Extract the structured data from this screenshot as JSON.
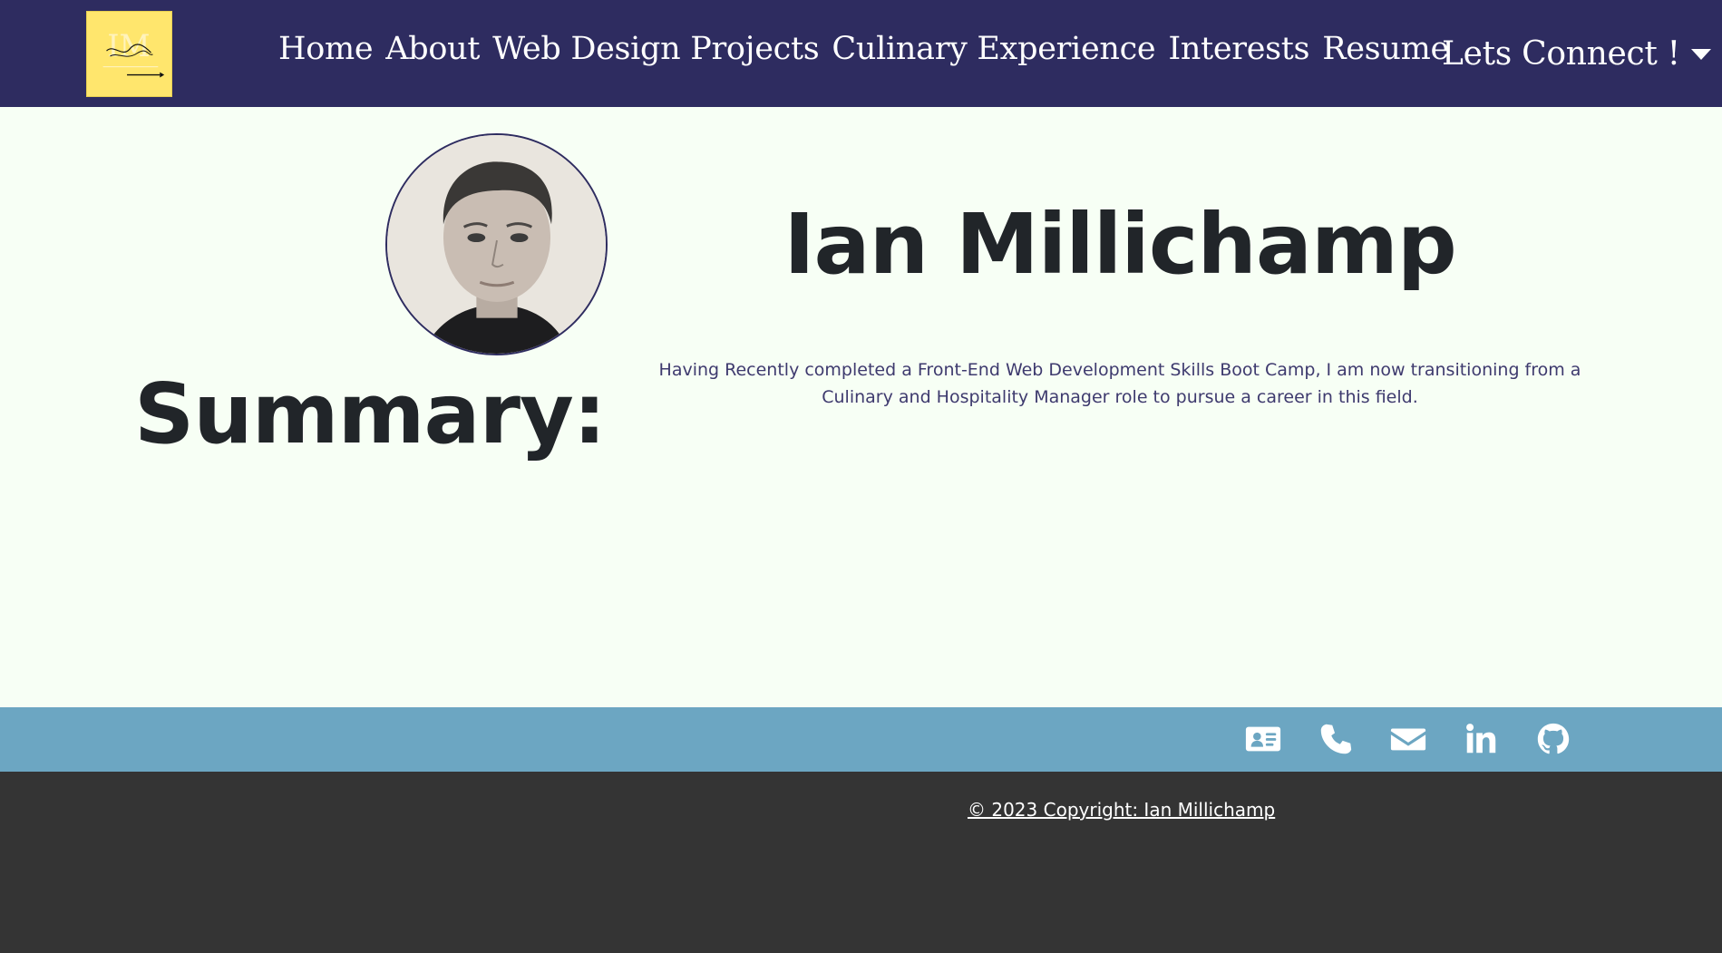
{
  "navbar": {
    "background": "#2e2c60",
    "logo_icon": "IM-monogram-logo",
    "links": [
      {
        "label": "Home"
      },
      {
        "label": "About"
      },
      {
        "label": "Web Design Projects"
      },
      {
        "label": "Culinary Experience"
      },
      {
        "label": "Interests"
      },
      {
        "label": "Resume"
      }
    ],
    "connect_dropdown": {
      "label": "Lets Connect !",
      "icon": "caret-down-icon"
    }
  },
  "profile": {
    "avatar_icon": "profile-photo",
    "name": "Ian Millichamp"
  },
  "summary": {
    "title": "Summary:",
    "text": "Having Recently completed a Front-End Web Development Skills Boot Camp, I am now transitioning from a Culinary and Hospitality Manager role to pursue a career in this field."
  },
  "social_bar": {
    "background": "#6ca6c2",
    "icons": [
      "contact-card-icon",
      "phone-icon",
      "envelope-icon",
      "linkedin-icon",
      "github-icon"
    ]
  },
  "footer": {
    "background": "#343434",
    "copyright": "© 2023 Copyright: Ian Millichamp"
  },
  "colors": {
    "page_background": "#f7fff5",
    "logo_background": "#ffe66d",
    "heading": "#212529",
    "body_text": "#3e3a6e"
  }
}
